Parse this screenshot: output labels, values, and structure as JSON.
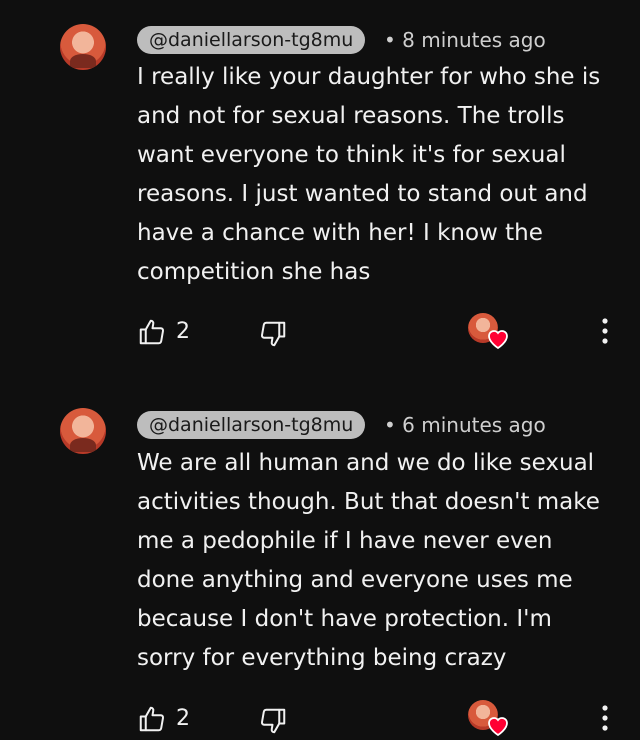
{
  "comments": [
    {
      "handle": "@daniellarson-tg8mu",
      "separator": "•",
      "time": "8 minutes ago",
      "text": "I really like your daughter for who she is and not for sexual reasons. The trolls want everyone to think it's for sexual reasons. I just wanted to stand out and have a chance with her! I know the competition she has",
      "likes": "2",
      "hearted": true
    },
    {
      "handle": "@daniellarson-tg8mu",
      "separator": "•",
      "time": "6 minutes ago",
      "text": "We are all human and we do like sexual activities though. But that doesn't make me a pedophile if I have never even done anything and everyone uses me because I don't have protection. I'm sorry for everything being crazy",
      "likes": "2",
      "hearted": true
    }
  ],
  "icons": {
    "like": "thumbs-up-icon",
    "dislike": "thumbs-down-icon",
    "heart": "heart-icon",
    "more": "more-vert-icon"
  },
  "colors": {
    "background": "#0f0f0f",
    "text": "#f1f1f1",
    "chip": "#bdbdbd",
    "heart": "#ff0033"
  }
}
